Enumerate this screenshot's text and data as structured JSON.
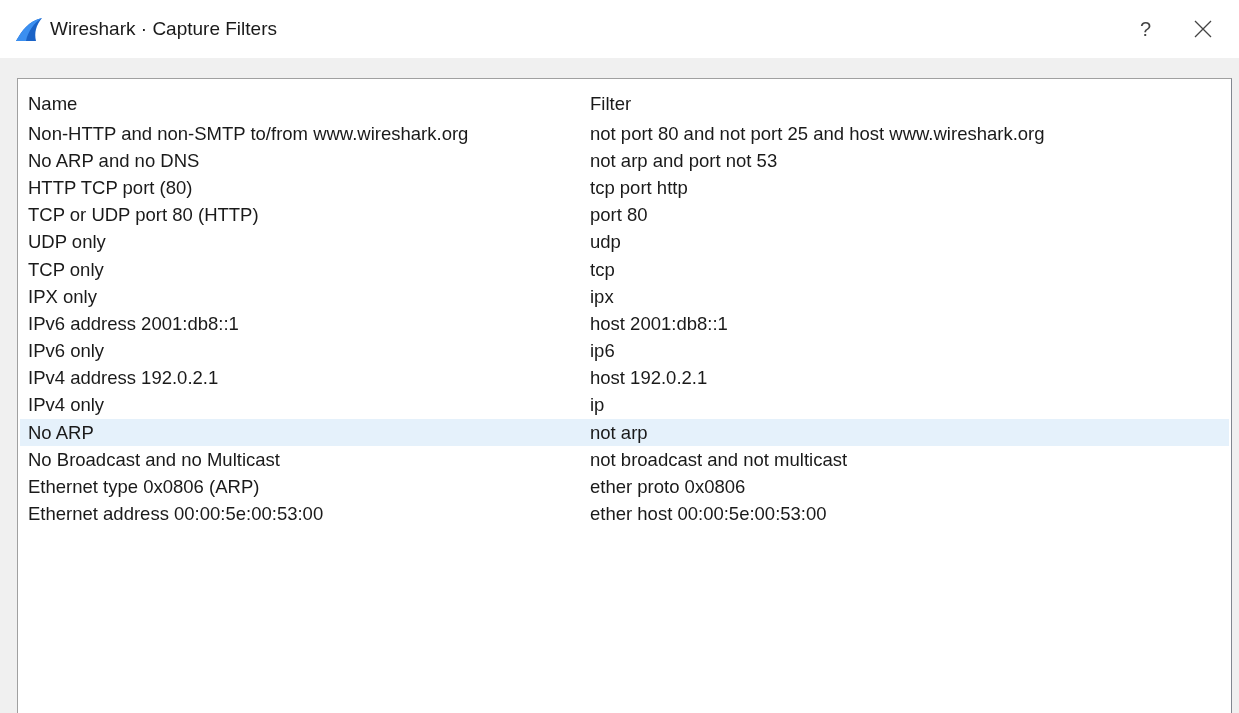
{
  "window": {
    "title": "Wireshark · Capture Filters",
    "help": "?"
  },
  "table": {
    "columns": [
      "Name",
      "Filter"
    ],
    "rows": [
      {
        "name": "Non-HTTP and non-SMTP to/from www.wireshark.org",
        "filter": "not port 80 and not port 25 and host www.wireshark.org",
        "selected": false
      },
      {
        "name": "No ARP and no DNS",
        "filter": "not arp and port not 53",
        "selected": false
      },
      {
        "name": "HTTP TCP port (80)",
        "filter": "tcp port http",
        "selected": false
      },
      {
        "name": "TCP or UDP port 80 (HTTP)",
        "filter": "port 80",
        "selected": false
      },
      {
        "name": "UDP only",
        "filter": "udp",
        "selected": false
      },
      {
        "name": "TCP only",
        "filter": "tcp",
        "selected": false
      },
      {
        "name": "IPX only",
        "filter": "ipx",
        "selected": false
      },
      {
        "name": "IPv6 address 2001:db8::1",
        "filter": "host 2001:db8::1",
        "selected": false
      },
      {
        "name": "IPv6 only",
        "filter": "ip6",
        "selected": false
      },
      {
        "name": "IPv4 address 192.0.2.1",
        "filter": "host 192.0.2.1",
        "selected": false
      },
      {
        "name": "IPv4 only",
        "filter": "ip",
        "selected": false
      },
      {
        "name": "No ARP",
        "filter": "not arp",
        "selected": true
      },
      {
        "name": "No Broadcast and no Multicast",
        "filter": "not broadcast and not multicast",
        "selected": false
      },
      {
        "name": "Ethernet type 0x0806 (ARP)",
        "filter": "ether proto 0x0806",
        "selected": false
      },
      {
        "name": "Ethernet address 00:00:5e:00:53:00",
        "filter": "ether host 00:00:5e:00:53:00",
        "selected": false
      }
    ]
  }
}
